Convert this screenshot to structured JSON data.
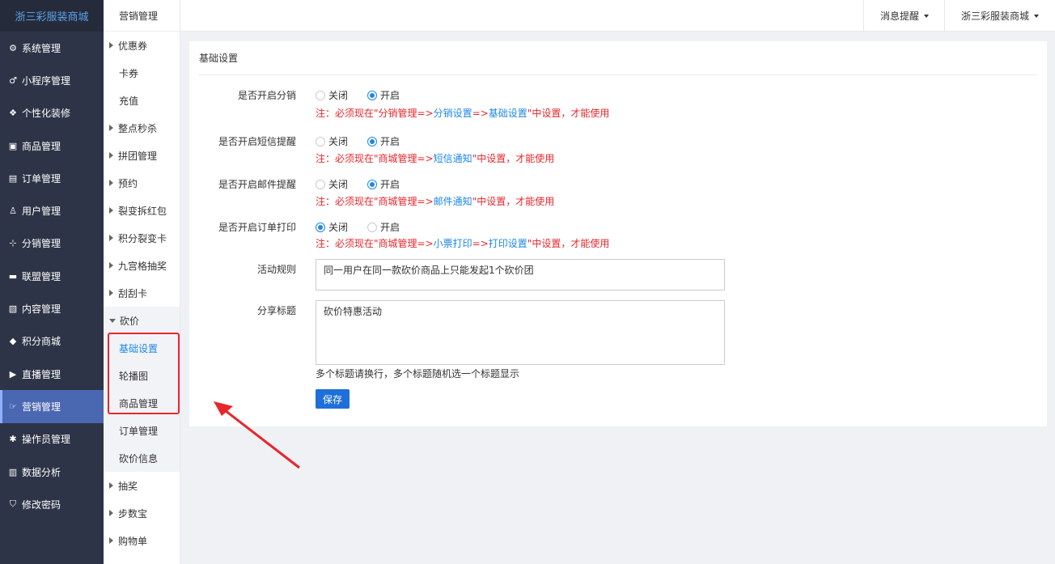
{
  "brand": "浙三彩服装商城",
  "main_nav": [
    {
      "label": "系统管理",
      "icon": "gear-icon",
      "glyph": "⚙"
    },
    {
      "label": "小程序管理",
      "icon": "link-icon",
      "glyph": "♂"
    },
    {
      "label": "个性化装修",
      "icon": "paint-icon",
      "glyph": "❖"
    },
    {
      "label": "商品管理",
      "icon": "bag-icon",
      "glyph": "▣"
    },
    {
      "label": "订单管理",
      "icon": "order-icon",
      "glyph": "▤"
    },
    {
      "label": "用户管理",
      "icon": "user-icon",
      "glyph": "♙"
    },
    {
      "label": "分销管理",
      "icon": "sitemap-icon",
      "glyph": "⊹"
    },
    {
      "label": "联盟管理",
      "icon": "alliance-icon",
      "glyph": "▬"
    },
    {
      "label": "内容管理",
      "icon": "content-icon",
      "glyph": "▧"
    },
    {
      "label": "积分商城",
      "icon": "cube-icon",
      "glyph": "◆"
    },
    {
      "label": "直播管理",
      "icon": "play-icon",
      "glyph": "▶"
    },
    {
      "label": "营销管理",
      "icon": "hand-icon",
      "glyph": "☞",
      "active": true
    },
    {
      "label": "操作员管理",
      "icon": "cog-icon",
      "glyph": "✱"
    },
    {
      "label": "数据分析",
      "icon": "bar-chart-icon",
      "glyph": "▥"
    },
    {
      "label": "修改密码",
      "icon": "shield-icon",
      "glyph": "⛉"
    }
  ],
  "sub_header": "营销管理",
  "sub_nav": {
    "coupon": "优惠券",
    "card": "卡券",
    "recharge": "充值",
    "flash": "整点秒杀",
    "group": "拼团管理",
    "booking": "预约",
    "fission_red": "裂变拆红包",
    "points_card": "积分裂变卡",
    "grid_lottery": "九宫格抽奖",
    "scratch": "刮刮卡",
    "bargain": "砍价",
    "bargain_basic": "基础设置",
    "bargain_carousel": "轮播图",
    "bargain_goods": "商品管理",
    "bargain_orders": "订单管理",
    "bargain_info": "砍价信息",
    "lottery": "抽奖",
    "steps": "步数宝",
    "shopping_list": "购物单"
  },
  "topbar": {
    "messages": "消息提醒",
    "store": "浙三彩服装商城"
  },
  "panel": {
    "title": "基础设置",
    "off_label": "关闭",
    "on_label": "开启",
    "rows": {
      "distribution": {
        "label": "是否开启分销",
        "selected": "开启",
        "note_pre": "注：必须现在\"",
        "note_red1": "分销管理=>",
        "note_blue1": "分销设置",
        "note_red2": "=>",
        "note_blue2": "基础设置",
        "note_post": "\"中设置，才能使用"
      },
      "sms": {
        "label": "是否开启短信提醒",
        "selected": "开启",
        "note_pre": "注：必须现在\"",
        "note_red1": "商城管理=>",
        "note_blue1": "短信通知",
        "note_post": "\"中设置，才能使用"
      },
      "email": {
        "label": "是否开启邮件提醒",
        "selected": "开启",
        "note_pre": "注：必须现在\"",
        "note_red1": "商城管理=>",
        "note_blue1": "邮件通知",
        "note_post": "\"中设置，才能使用"
      },
      "print": {
        "label": "是否开启订单打印",
        "selected": "关闭",
        "note_pre": "注：必须现在\"",
        "note_red1": "商城管理=>",
        "note_blue1": "小票打印",
        "note_red2": "=>",
        "note_blue2": "打印设置",
        "note_post": "\"中设置，才能使用"
      }
    },
    "rules_label": "活动规则",
    "rules_value": "同一用户在同一款砍价商品上只能发起1个砍价团",
    "share_label": "分享标题",
    "share_value": "砍价特惠活动",
    "share_hint": "多个标题请换行，多个标题随机选一个标题显示",
    "save": "保存"
  },
  "colors": {
    "sidebar_bg": "#2e3447",
    "active_bg": "#4a67b2",
    "accent": "#1e88e5",
    "note_red": "#e8262b"
  }
}
